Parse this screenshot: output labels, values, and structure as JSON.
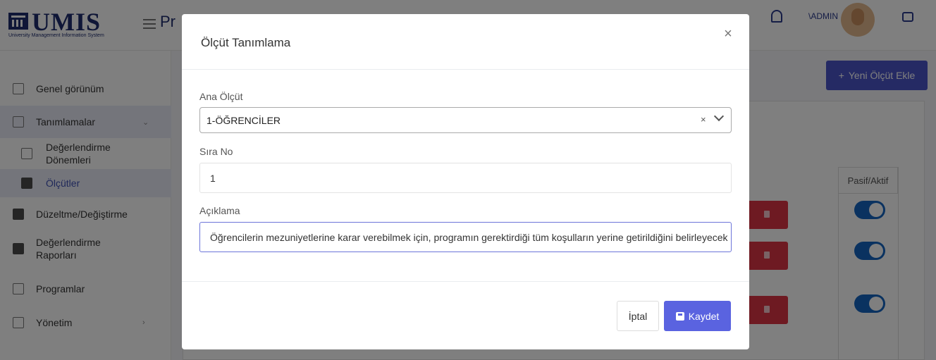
{
  "app": {
    "logo_text": "UMIS",
    "logo_subtitle": "University Management Information System",
    "page_title": "Pr",
    "user_label": "\\ADMIN"
  },
  "sidebar": {
    "items": [
      {
        "label": "Genel görünüm",
        "icon": "chart-icon"
      },
      {
        "label": "Tanımlamalar",
        "icon": "folder-icon",
        "expanded": true
      },
      {
        "label": "Değerlendirme Dönemleri",
        "icon": "folder-icon",
        "sub": true
      },
      {
        "label": "Ölçütler",
        "icon": "document-icon",
        "sub": true,
        "selected": true
      },
      {
        "label": "Düzeltme/Değiştirme",
        "icon": "document-icon"
      },
      {
        "label": "Değerlendirme Raporları",
        "icon": "document-icon"
      },
      {
        "label": "Programlar",
        "icon": "list-icon"
      },
      {
        "label": "Yönetim",
        "icon": "settings-panel-icon"
      }
    ]
  },
  "main": {
    "new_button_label": "Yeni Ölçüt Ekle",
    "table_header_status": "Pasif/Aktif"
  },
  "modal": {
    "title": "Ölçüt Tanımlama",
    "close_symbol": "×",
    "ana_olcut_label": "Ana Ölçüt",
    "ana_olcut_value": "1-ÖĞRENCİLER",
    "clear_symbol": "×",
    "sira_no_label": "Sıra No",
    "sira_no_value": "1",
    "aciklama_label": "Açıklama",
    "aciklama_value": "Öğrencilerin mezuniyetlerine karar verebilmek için, programın gerektirdiği tüm koşulların yerine getirildiğini belirleyecek güver",
    "cancel_label": "İptal",
    "save_label": "Kaydet"
  },
  "colors": {
    "primary": "#5a63e0",
    "danger": "#dc3545",
    "toggle": "#1565c0",
    "brand": "#1f2d6e"
  }
}
